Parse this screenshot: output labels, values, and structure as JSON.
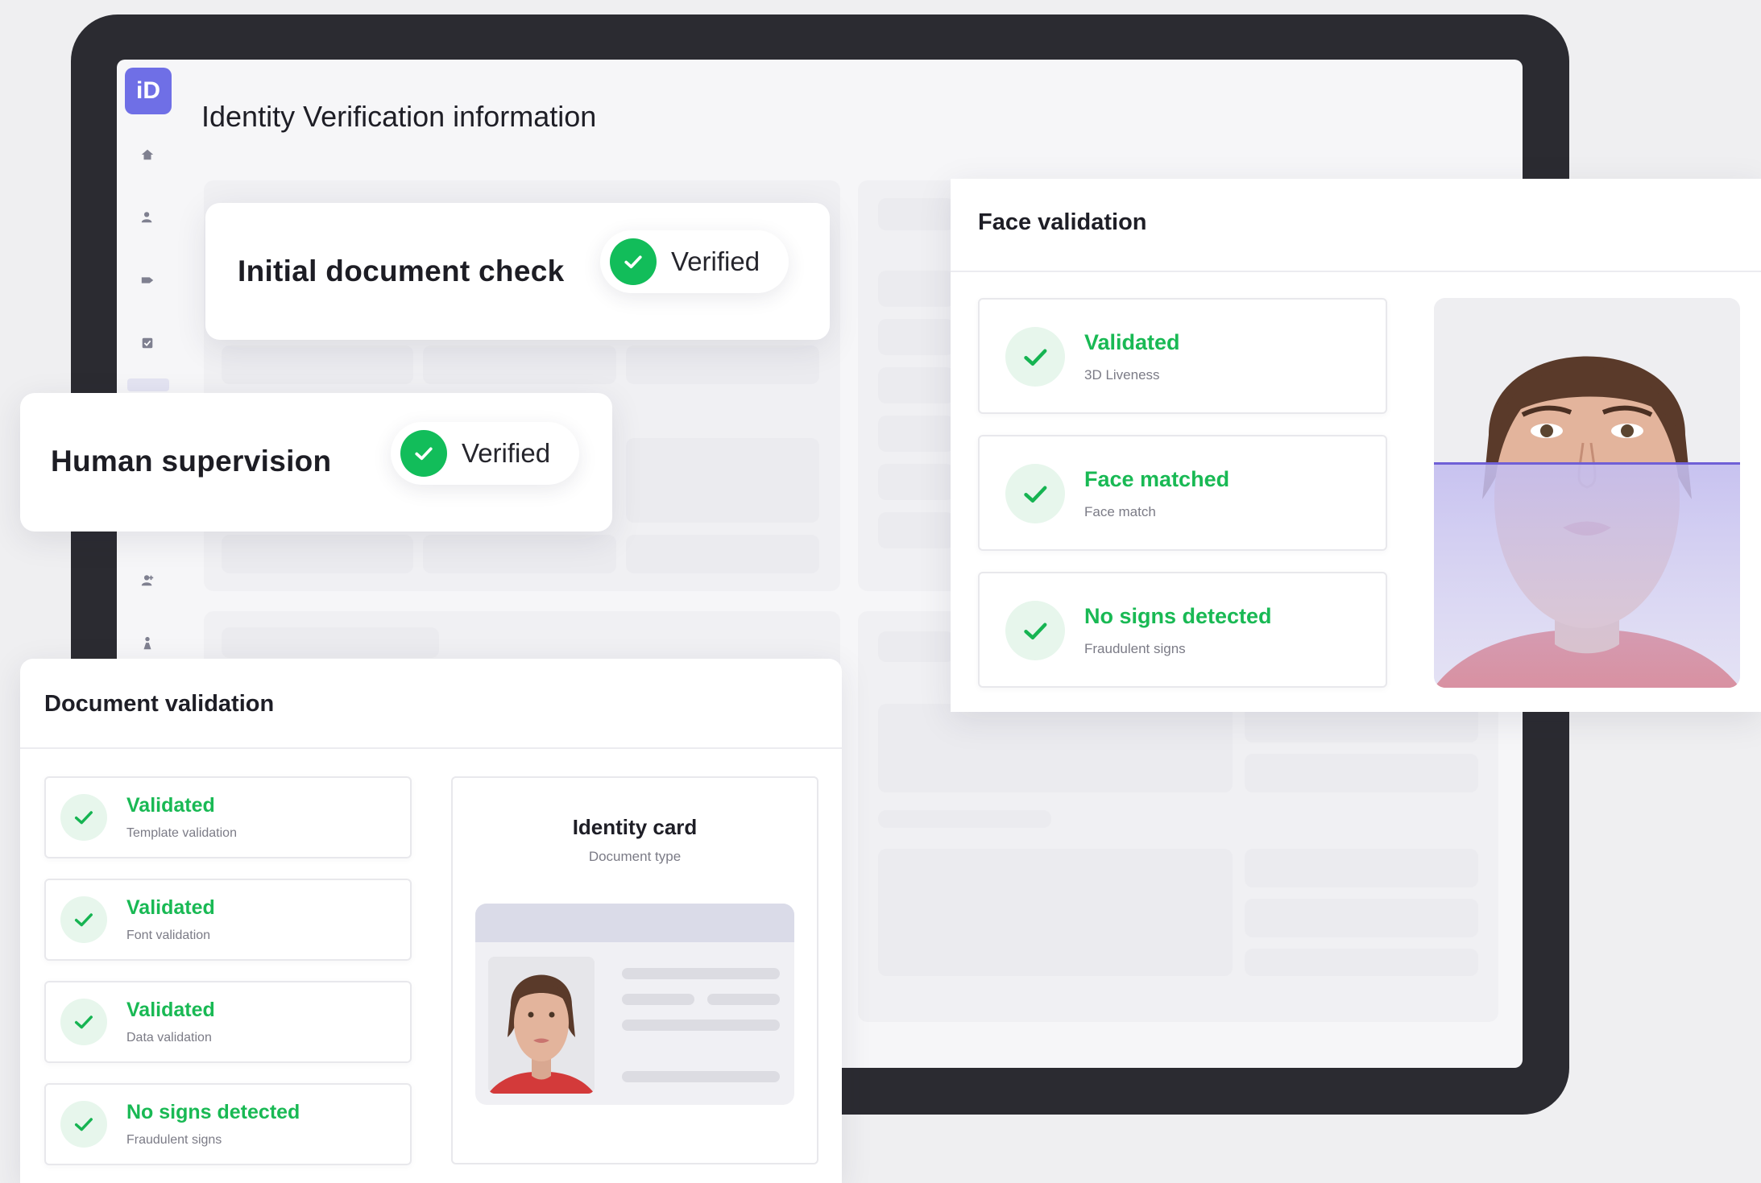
{
  "app": {
    "logo_text": "iD",
    "page_title": "Identity Verification information"
  },
  "sidebar": {
    "icons": [
      "home-icon",
      "user-icon",
      "tag-icon",
      "checklist-icon",
      "add-user-icon",
      "person-icon"
    ]
  },
  "colors": {
    "accent": "#6f6fe6",
    "success": "#12bd5a",
    "success_text": "#19b954",
    "frame": "#2b2b31"
  },
  "initial_check": {
    "title": "Initial document check",
    "status": "Verified"
  },
  "human_supervision": {
    "title": "Human supervision",
    "status": "Verified"
  },
  "face_validation": {
    "title": "Face validation",
    "items": [
      {
        "title": "Validated",
        "subtitle": "3D Liveness"
      },
      {
        "title": "Face matched",
        "subtitle": "Face match"
      },
      {
        "title": "No signs detected",
        "subtitle": "Fraudulent signs"
      }
    ]
  },
  "document_validation": {
    "title": "Document validation",
    "items": [
      {
        "title": "Validated",
        "subtitle": "Template validation"
      },
      {
        "title": "Validated",
        "subtitle": "Font validation"
      },
      {
        "title": "Validated",
        "subtitle": "Data validation"
      },
      {
        "title": "No signs detected",
        "subtitle": "Fraudulent signs"
      }
    ],
    "document": {
      "name": "Identity card",
      "type": "Document type"
    }
  }
}
